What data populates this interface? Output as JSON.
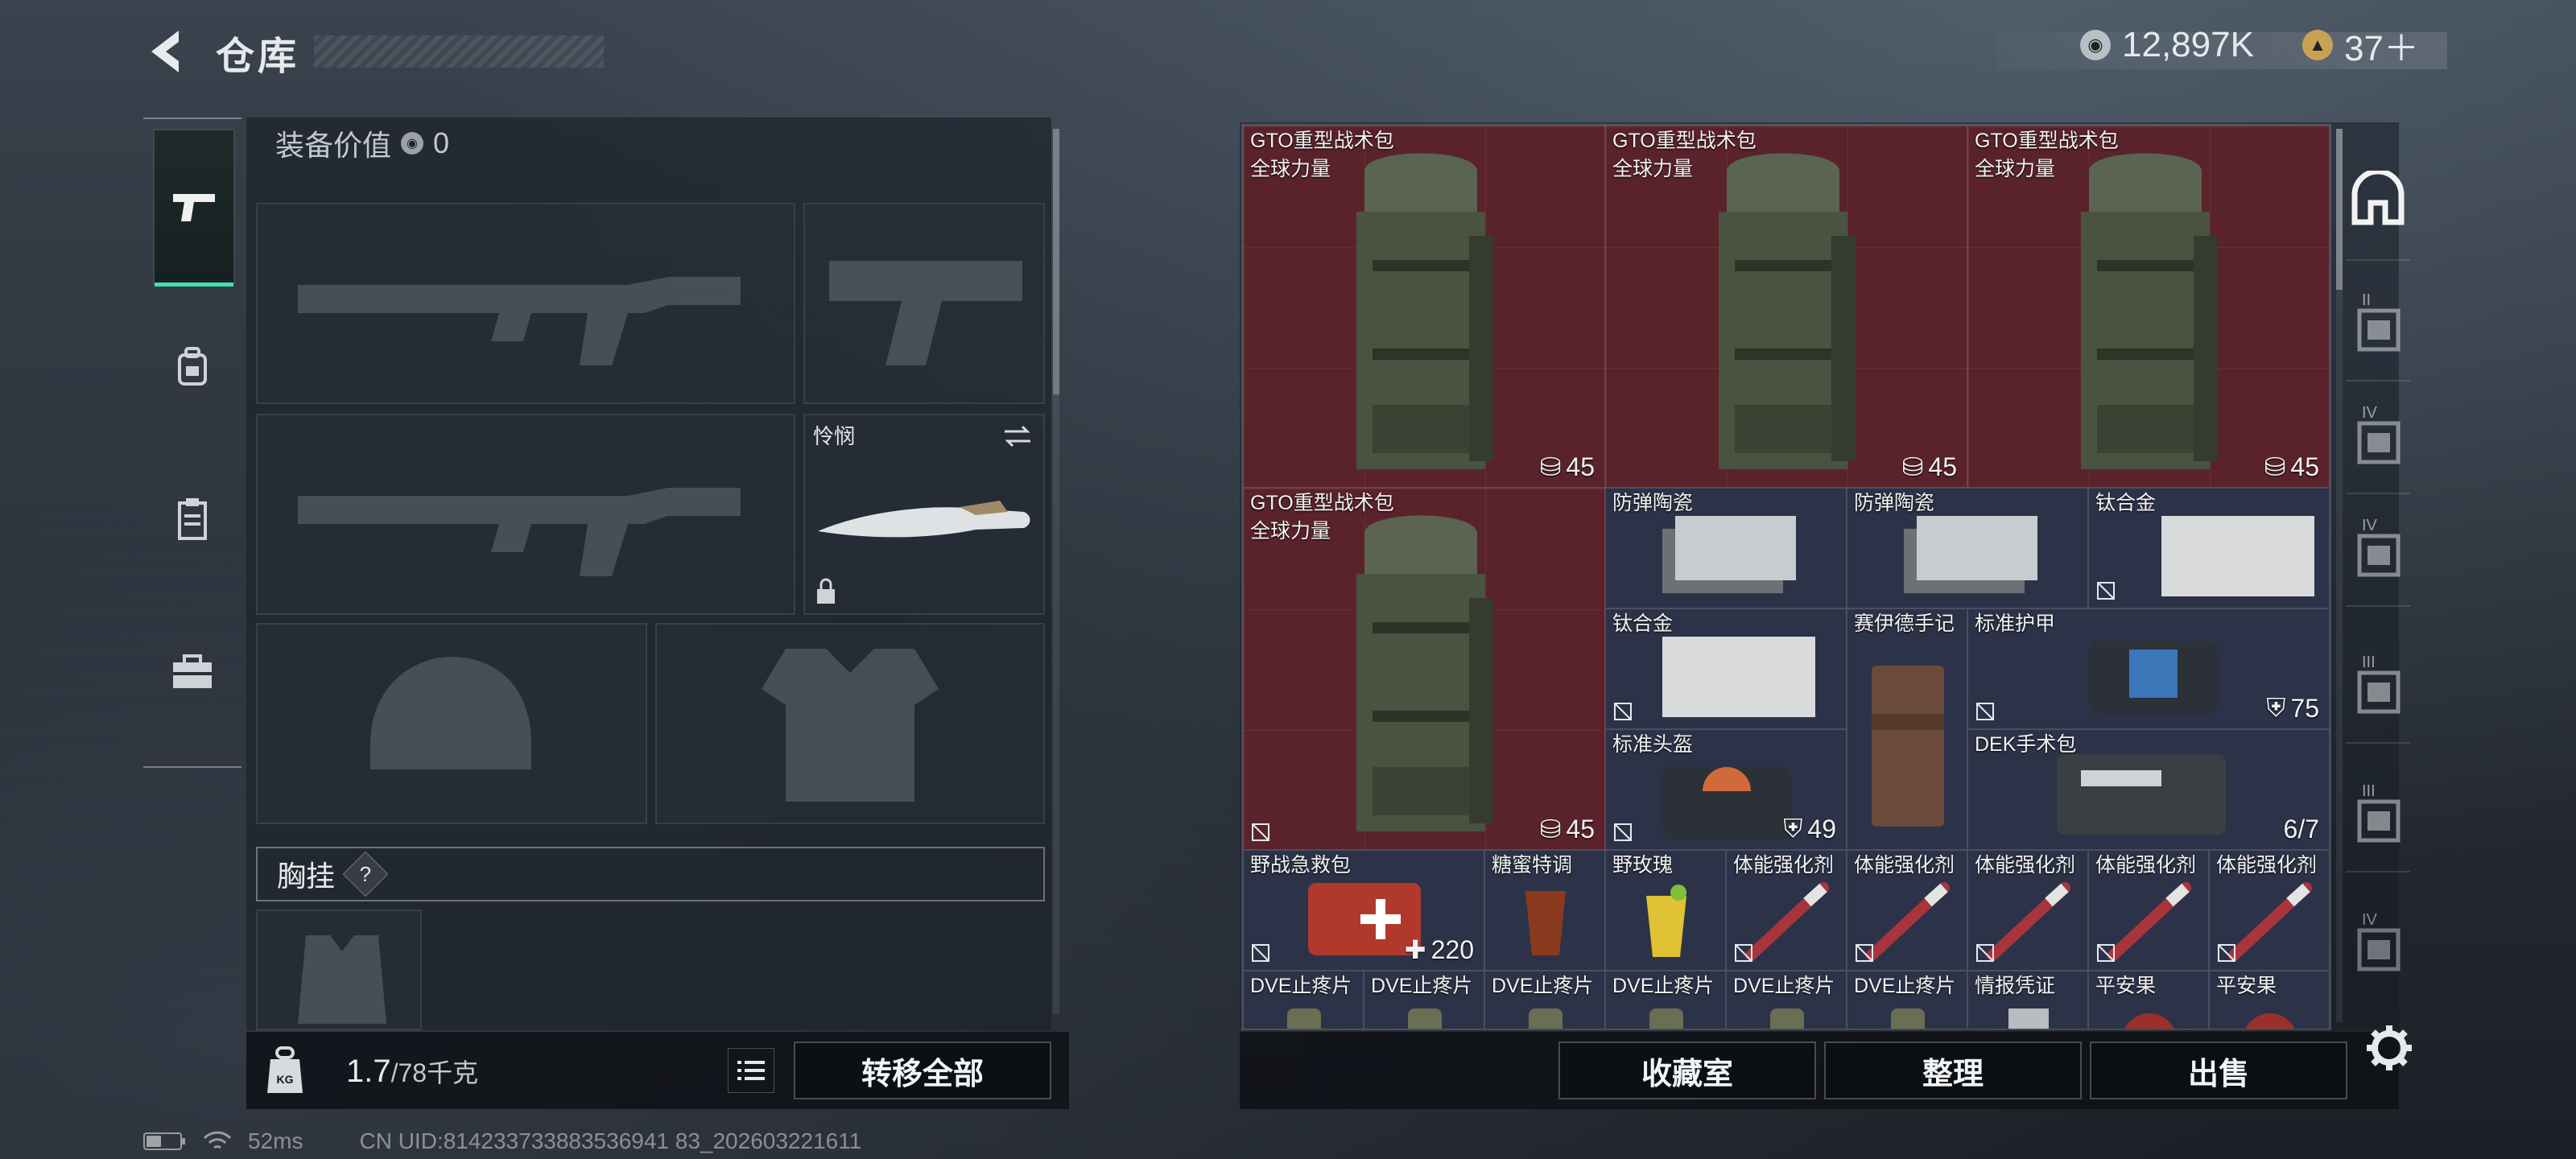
{
  "header": {
    "title": "仓库",
    "currency_main": "12,897K",
    "currency_secondary": "37＋"
  },
  "equipment": {
    "value_label": "装备价值",
    "value": "0",
    "melee_slot_label": "怜悯",
    "chest_rig_label": "胸挂",
    "chest_rig_help": "?"
  },
  "weight": {
    "current": "1.7",
    "max": "/78千克"
  },
  "buttons": {
    "transfer_all": "转移全部",
    "collection": "收藏室",
    "sort": "整理",
    "sell": "出售"
  },
  "status": {
    "ping": "52ms",
    "uid": "CN UID:814233733883536941 83_202603221611"
  },
  "storage": {
    "items": [
      {
        "name": "GTO重型战术包",
        "sub": "全球力量",
        "count": "45"
      },
      {
        "name": "GTO重型战术包",
        "sub": "全球力量",
        "count": "45"
      },
      {
        "name": "GTO重型战术包",
        "sub": "全球力量",
        "count": "45"
      },
      {
        "name": "GTO重型战术包",
        "sub": "全球力量",
        "count": "45"
      },
      {
        "name": "防弹陶瓷"
      },
      {
        "name": "防弹陶瓷"
      },
      {
        "name": "钛合金"
      },
      {
        "name": "钛合金"
      },
      {
        "name": "赛伊德手记"
      },
      {
        "name": "标准护甲",
        "count": "75"
      },
      {
        "name": "标准头盔",
        "count": "49"
      },
      {
        "name": "DEK手术包",
        "count": "6/7"
      },
      {
        "name": "野战急救包",
        "count": "220"
      },
      {
        "name": "糖蜜特调"
      },
      {
        "name": "野玫瑰"
      },
      {
        "name": "体能强化剂"
      },
      {
        "name": "体能强化剂"
      },
      {
        "name": "体能强化剂"
      },
      {
        "name": "体能强化剂"
      },
      {
        "name": "体能强化剂"
      },
      {
        "name": "DVE止疼片"
      },
      {
        "name": "DVE止疼片"
      },
      {
        "name": "DVE止疼片"
      },
      {
        "name": "DVE止疼片"
      },
      {
        "name": "DVE止疼片"
      },
      {
        "name": "DVE止疼片"
      },
      {
        "name": "情报凭证"
      },
      {
        "name": "平安果"
      },
      {
        "name": "平安果"
      }
    ]
  },
  "right_tabs": [
    "",
    "II",
    "IV",
    "IV",
    "III",
    "III",
    "IV"
  ],
  "colors": {
    "accent": "#3fe0b5",
    "rare_red": "#5a232b",
    "rare_blue": "#2c3348"
  }
}
